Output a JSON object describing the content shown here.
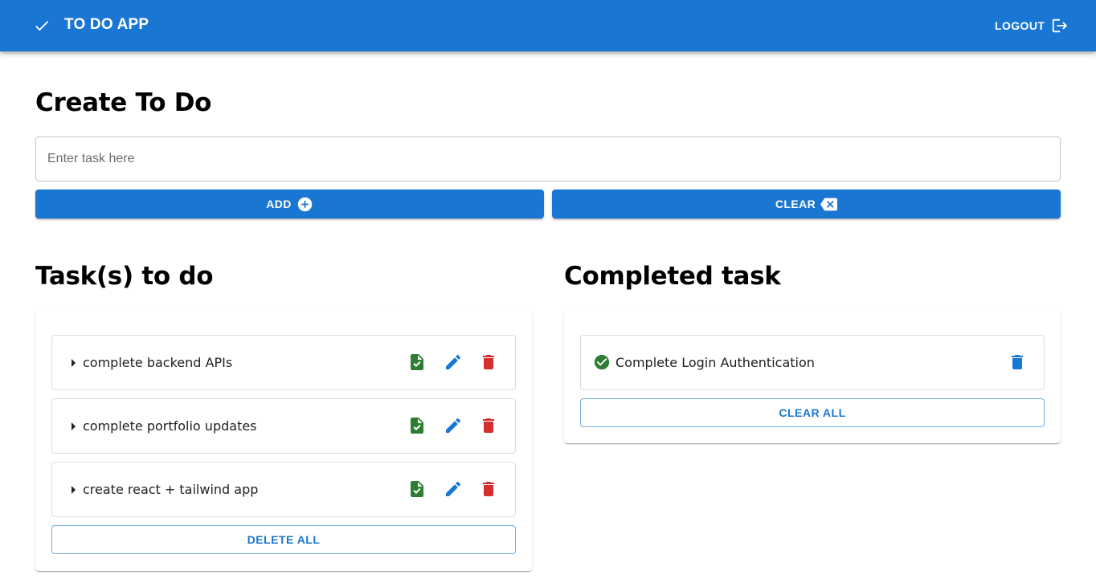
{
  "header": {
    "title": "TO DO APP",
    "logout_label": "LOGOUT"
  },
  "create": {
    "heading": "Create To Do",
    "input_placeholder": "Enter task here",
    "input_value": "",
    "add_label": "ADD",
    "clear_label": "CLEAR"
  },
  "todo": {
    "heading": "Task(s) to do",
    "items": [
      {
        "text": "complete backend APIs"
      },
      {
        "text": "complete portfolio updates"
      },
      {
        "text": "create react + tailwind app"
      }
    ],
    "delete_all_label": "DELETE ALL"
  },
  "completed": {
    "heading": "Completed task",
    "items": [
      {
        "text": "Complete Login Authentication"
      }
    ],
    "clear_all_label": "CLEAR ALL"
  },
  "colors": {
    "primary": "#1976d2",
    "success": "#2e7d32",
    "error": "#d32f2f"
  }
}
